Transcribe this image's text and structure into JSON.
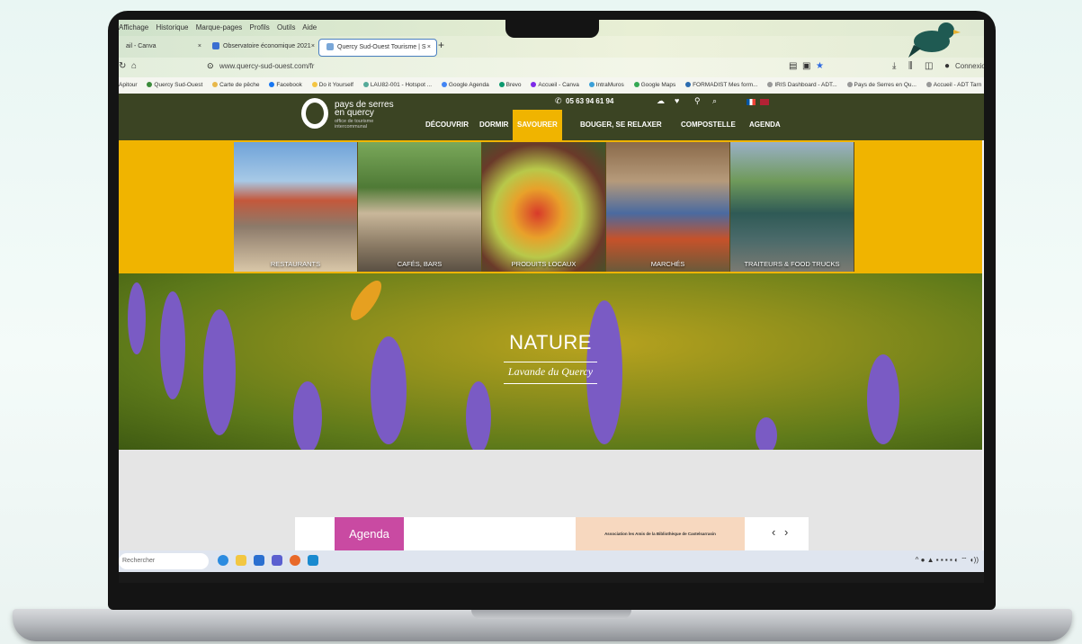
{
  "browser": {
    "menu": [
      "Affichage",
      "Historique",
      "Marque-pages",
      "Profils",
      "Outils",
      "Aide"
    ],
    "tabs": [
      {
        "label": "ail - Canva"
      },
      {
        "label": "Observatoire économique 2021"
      },
      {
        "label": "Quercy Sud-Ouest Tourisme | S"
      }
    ],
    "new_tab": "+",
    "url": "www.quercy-sud-ouest.com/fr",
    "bookmarks": [
      "Apitour",
      "Quercy Sud-Ouest",
      "Carte de pêche",
      "Facebook",
      "Do it Yourself",
      "LAU82-001 - Hotspot ...",
      "Google Agenda",
      "Brevo",
      "Accueil - Canva",
      "IntraMuros",
      "Google Maps",
      "FORMADIST Mes form...",
      "IRIS Dashboard - ADT...",
      "Pays de Serres en Qu...",
      "Accueil - ADT Tarn"
    ],
    "connection_label": "Connexion"
  },
  "site": {
    "logo": {
      "line1": "pays de serres",
      "line2": "en quercy",
      "sub": "office de tourisme intercommunal"
    },
    "phone": "05 63 94 61 94",
    "menu": [
      "DÉCOUVRIR",
      "DORMIR",
      "SAVOURER",
      "BOUGER, SE RELAXER",
      "COMPOSTELLE",
      "AGENDA"
    ],
    "active_menu": "SAVOURER",
    "tiles": [
      "RESTAURANTS",
      "CAFÉS, BARS",
      "PRODUITS LOCAUX",
      "MARCHÉS",
      "TRAITEURS & FOOD TRUCKS"
    ],
    "hero": {
      "title": "NATURE",
      "subtitle": "Lavande du Quercy"
    },
    "agenda": {
      "button": "Agenda",
      "event": "Association les Amis de la Bibliothèque de Castelsarrasin",
      "arrows": "‹ ›"
    },
    "colors": {
      "header": "#3b4423",
      "accent": "#f0b400",
      "agenda": "#c94aa2"
    }
  },
  "taskbar": {
    "search_placeholder": "Rechercher"
  }
}
